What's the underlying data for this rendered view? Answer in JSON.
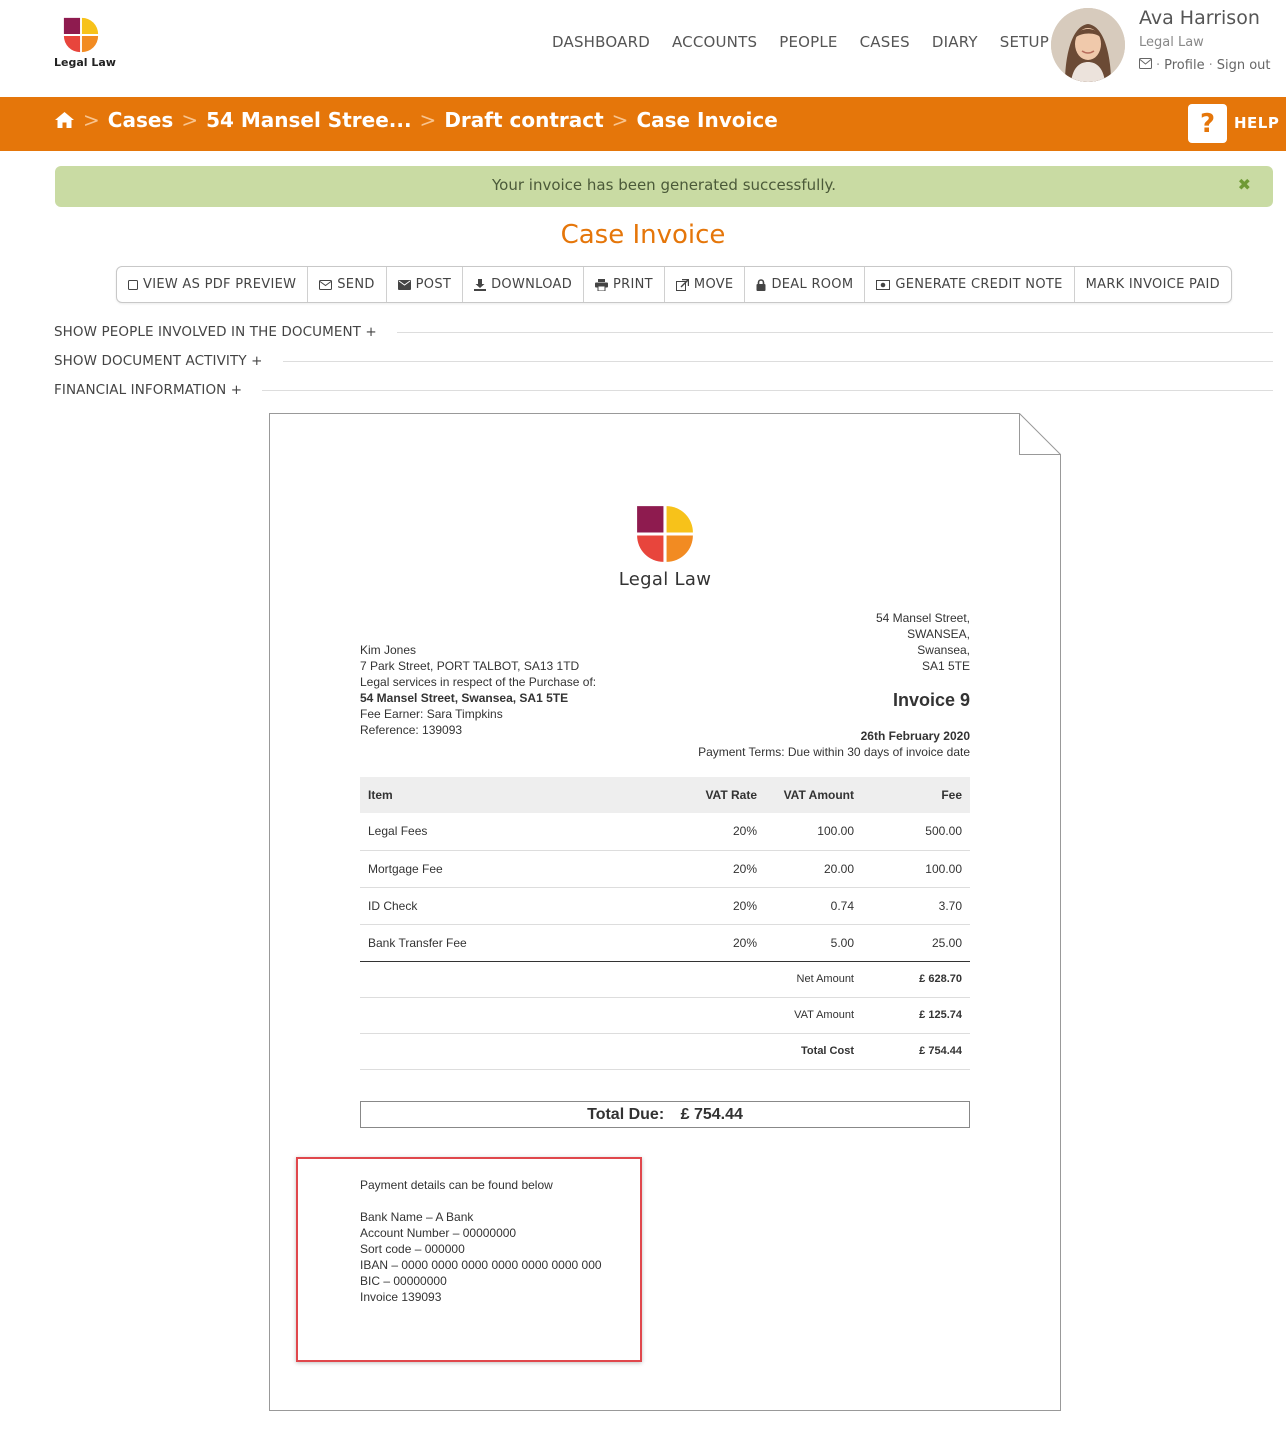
{
  "brand": {
    "name": "Legal Law",
    "colors": {
      "accent": "#e5760a",
      "alert_bg": "#c9dba3",
      "highlight": "#e0474c"
    }
  },
  "nav": {
    "items": [
      {
        "label": "DASHBOARD"
      },
      {
        "label": "ACCOUNTS"
      },
      {
        "label": "PEOPLE"
      },
      {
        "label": "CASES"
      },
      {
        "label": "DIARY"
      },
      {
        "label": "SETUP"
      }
    ]
  },
  "user": {
    "name": "Ava Harrison",
    "firm": "Legal Law",
    "profile_label": "Profile",
    "sign_out_label": "Sign out",
    "mail_icon": "envelope-icon"
  },
  "breadcrumb": {
    "home_icon": "home-icon",
    "items": [
      "Cases",
      "54 Mansel Stree...",
      "Draft contract",
      "Case Invoice"
    ]
  },
  "help": {
    "icon_text": "?",
    "label": "HELP"
  },
  "alert": {
    "message": "Your invoice has been generated successfully.",
    "close": "✖"
  },
  "page_title": "Case Invoice",
  "toolbar": {
    "buttons": [
      {
        "label": "VIEW AS PDF PREVIEW",
        "icon": "checkbox-icon"
      },
      {
        "label": "SEND",
        "icon": "envelope-icon"
      },
      {
        "label": "POST",
        "icon": "envelope-filled-icon"
      },
      {
        "label": "DOWNLOAD",
        "icon": "download-icon"
      },
      {
        "label": "PRINT",
        "icon": "print-icon"
      },
      {
        "label": "MOVE",
        "icon": "external-link-icon"
      },
      {
        "label": "DEAL ROOM",
        "icon": "lock-icon"
      },
      {
        "label": "GENERATE CREDIT NOTE",
        "icon": "money-icon"
      },
      {
        "label": "MARK INVOICE PAID",
        "icon": ""
      }
    ]
  },
  "sections": [
    {
      "label": "SHOW PEOPLE INVOLVED IN THE DOCUMENT +"
    },
    {
      "label": "SHOW DOCUMENT ACTIVITY +"
    },
    {
      "label": "FINANCIAL INFORMATION +"
    }
  ],
  "invoice": {
    "logo_text": "Legal Law",
    "firm_address": [
      "54 Mansel Street,",
      "SWANSEA,",
      "Swansea,",
      "SA1 5TE"
    ],
    "client": {
      "name": "Kim Jones",
      "address": "7 Park Street, PORT TALBOT, SA13 1TD",
      "services": "Legal services in respect of the Purchase of:",
      "property": "54 Mansel Street, Swansea, SA1 5TE",
      "fee_earner": "Fee Earner: Sara Timpkins",
      "reference": "Reference: 139093"
    },
    "title": "Invoice 9",
    "date": "26th February 2020",
    "payment_terms": "Payment Terms: Due within 30 days of invoice date",
    "columns": {
      "item": "Item",
      "vat_rate": "VAT Rate",
      "vat_amount": "VAT Amount",
      "fee": "Fee"
    },
    "rows": [
      {
        "item": "Legal Fees",
        "vat_rate": "20%",
        "vat_amount": "100.00",
        "fee": "500.00"
      },
      {
        "item": "Mortgage Fee",
        "vat_rate": "20%",
        "vat_amount": "20.00",
        "fee": "100.00"
      },
      {
        "item": "ID Check",
        "vat_rate": "20%",
        "vat_amount": "0.74",
        "fee": "3.70"
      },
      {
        "item": "Bank Transfer Fee",
        "vat_rate": "20%",
        "vat_amount": "5.00",
        "fee": "25.00"
      }
    ],
    "summary": [
      {
        "label": "Net Amount",
        "value": "£ 628.70"
      },
      {
        "label": "VAT Amount",
        "value": "£ 125.74"
      },
      {
        "label": "Total Cost",
        "value": "£ 754.44"
      }
    ],
    "total_due_label": "Total Due:",
    "total_due_value": "£ 754.44",
    "payment_details": {
      "intro": "Payment details can be found below",
      "lines": [
        "Bank Name – A Bank",
        "Account Number – 00000000",
        "Sort code – 000000",
        "IBAN –  0000 0000 0000 0000 0000 0000 000",
        "BIC – 00000000",
        "Invoice 139093"
      ]
    }
  }
}
